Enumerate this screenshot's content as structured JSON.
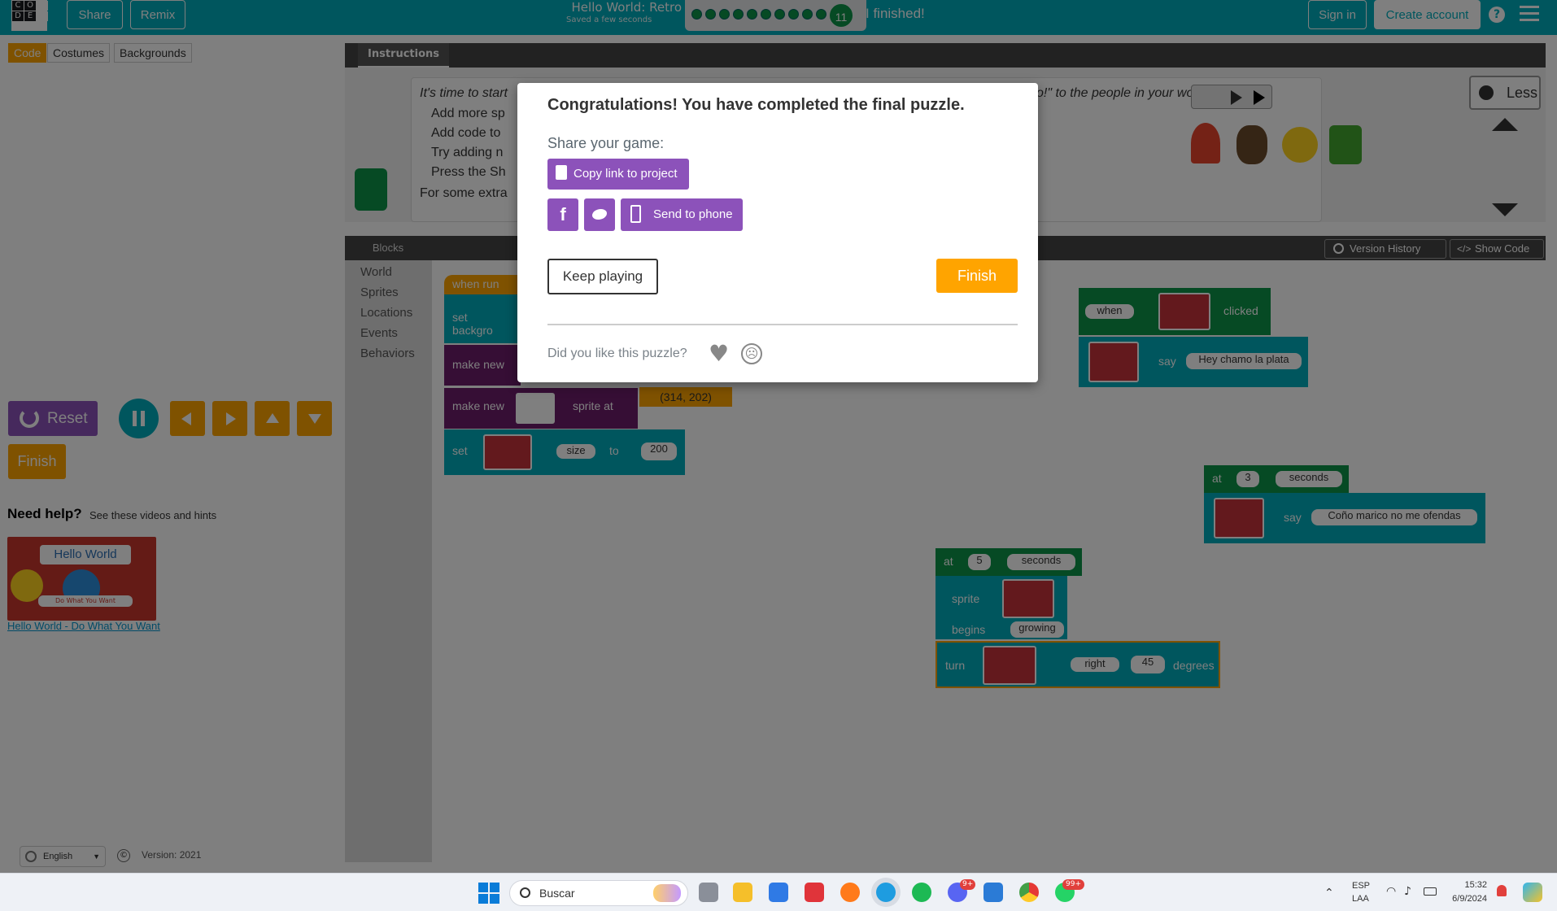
{
  "header": {
    "logo_letters": [
      "C",
      "O",
      "",
      "D",
      "E",
      ""
    ],
    "share_label": "Share",
    "remix_label": "Remix",
    "level_title": "Hello World: Retro",
    "saved_status": "Saved a few seconds",
    "level_number": "11",
    "finished_text": "I finished!",
    "sign_in_label": "Sign in",
    "create_account_label": "Create account",
    "help_icon": "question-icon",
    "menu_icon": "hamburger-icon"
  },
  "side_tabs": {
    "code": "Code",
    "costumes": "Costumes",
    "backgrounds": "Backgrounds"
  },
  "left_panel": {
    "reset_label": "Reset",
    "finish_label": "Finish",
    "need_help_title": "Need help?",
    "need_help_sub": "See these videos and hints",
    "video_thumb_title": "Hello World",
    "video_thumb_sub": "Do What You Want",
    "video_link": "Hello World - Do What You Want",
    "language": "English",
    "version": "Version: 2021"
  },
  "instructions": {
    "tab_label": "Instructions",
    "intro": "It's time to start",
    "intro_end": "o!\" to the people in your world!",
    "bullets": [
      "Add more sp",
      "Add code to",
      "Try adding n",
      "Press the Sh"
    ],
    "extra": "For some extra",
    "less_label": "Less"
  },
  "workspace": {
    "blocks_tab": "Blocks",
    "version_history": "Version History",
    "show_code": "Show Code",
    "toolbox": [
      "World",
      "Sprites",
      "Locations",
      "Events",
      "Behaviors"
    ],
    "when_run": "when run",
    "set_background": "set backgro",
    "make_new_1": "make new",
    "make_new_2": "make new",
    "sprite_at": "sprite at",
    "coords": "(314, 202)",
    "set": "set",
    "size": "size",
    "to": "to",
    "size_value": "200",
    "when_clicked": {
      "when": "when",
      "clicked": "clicked",
      "say": "say",
      "text": "Hey chamo la plata"
    },
    "at3": {
      "at": "at",
      "value": "3",
      "unit": "seconds",
      "say": "say",
      "text": "Coño marico no me ofendas"
    },
    "at5": {
      "at": "at",
      "value": "5",
      "unit": "seconds",
      "sprite": "sprite",
      "begins": "begins",
      "behavior": "growing",
      "turn": "turn",
      "direction": "right",
      "degrees_value": "45",
      "degrees": "degrees"
    }
  },
  "dialog": {
    "title": "Congratulations! You have completed the final puzzle.",
    "share_label": "Share your game:",
    "copy_link": "Copy link to project",
    "send_to_phone": "Send to phone",
    "keep_playing": "Keep playing",
    "finish": "Finish",
    "feedback_question": "Did you like this puzzle?"
  },
  "taskbar": {
    "search_placeholder": "Buscar",
    "lang_top": "ESP",
    "lang_bottom": "LAA",
    "time": "15:32",
    "date": "6/9/2024",
    "discord_badge": "9+",
    "whatsapp_badge": "99+"
  },
  "colors": {
    "brand_teal": "#00adbc",
    "orange": "#ffa400",
    "purple": "#8c52ba",
    "green": "#0d9448"
  }
}
